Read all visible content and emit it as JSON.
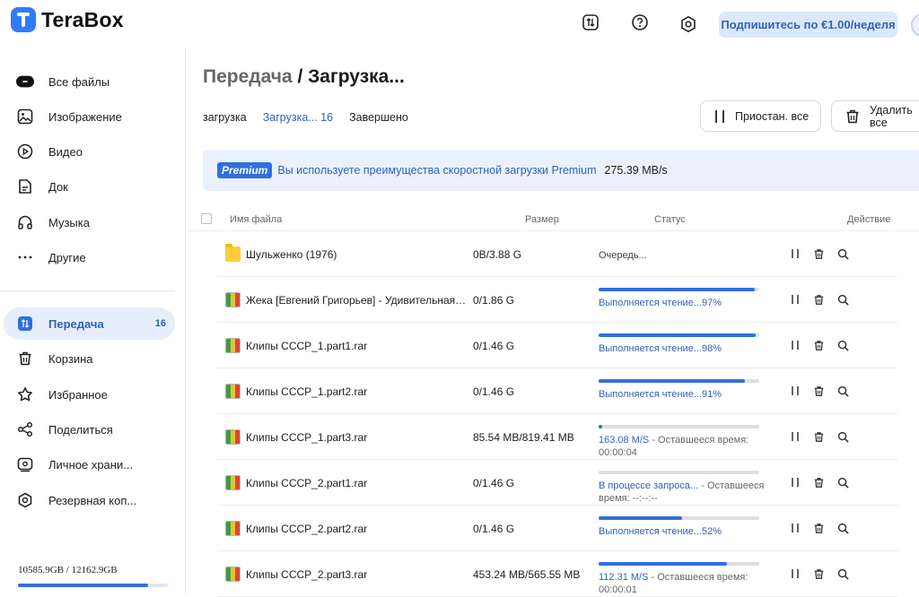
{
  "app": {
    "name": "TeraBox"
  },
  "header": {
    "subscribe_label": "Подпишитесь по €1.00/неделя"
  },
  "sidebar": {
    "items": [
      {
        "label": "Все файлы"
      },
      {
        "label": "Изображение"
      },
      {
        "label": "Видео"
      },
      {
        "label": "Док"
      },
      {
        "label": "Музыка"
      },
      {
        "label": "Другие"
      },
      {
        "label": "Передача",
        "count": "16"
      },
      {
        "label": "Корзина"
      },
      {
        "label": "Избранное"
      },
      {
        "label": "Поделиться"
      },
      {
        "label": "Личное храни..."
      },
      {
        "label": "Резервная коп..."
      }
    ],
    "storage": {
      "text": "10585.9GB / 12162.9GB",
      "used_fraction": 0.87
    }
  },
  "main": {
    "title_crumb": "Передача",
    "title_sep": " / ",
    "title_current": "Загрузка...",
    "tabs": [
      {
        "label": "загрузка"
      },
      {
        "label": "Загрузка... 16"
      },
      {
        "label": "Завершено"
      }
    ],
    "pause_all_label": "Приостан. все",
    "delete_label": "Удалить все",
    "banner": {
      "badge": "Premium",
      "text": "Вы используете преимущества скоростной загрузки Premium",
      "speed": "275.39 MB/s"
    },
    "columns": {
      "name": "Имя файла",
      "size": "Размер",
      "status": "Статус",
      "action": "Действие"
    },
    "rows": [
      {
        "type": "folder",
        "name": "Шульженко (1976)",
        "size": "0B/3.88 G",
        "status_plain": "Очередь...",
        "progress": null
      },
      {
        "type": "rar",
        "name": "Жека [Евгений Григорьев] - Удивительная жизнь",
        "size": "0/1.86 G",
        "status_main": "Выполняется чтение...97%",
        "status_extra": "",
        "progress": 0.97
      },
      {
        "type": "rar",
        "name": "Клипы СССР_1.part1.rar",
        "size": "0/1.46 G",
        "status_main": "Выполняется чтение...98%",
        "status_extra": "",
        "progress": 0.98
      },
      {
        "type": "rar",
        "name": "Клипы СССР_1.part2.rar",
        "size": "0/1.46 G",
        "status_main": "Выполняется чтение...91%",
        "status_extra": "",
        "progress": 0.91
      },
      {
        "type": "rar",
        "name": "Клипы СССР_1.part3.rar",
        "size": "85.54 MB/819.41 MB",
        "status_main": "163.08 M/S",
        "status_extra": " - Оставшееся время: 00:00:04",
        "progress": 0.02
      },
      {
        "type": "rar",
        "name": "Клипы СССР_2.part1.rar",
        "size": "0/1.46 G",
        "status_main": "В процессе запроса...",
        "status_extra": " - Оставшееся время: --:--:--",
        "progress": 0.0
      },
      {
        "type": "rar",
        "name": "Клипы СССР_2.part2.rar",
        "size": "0/1.46 G",
        "status_main": "Выполняется чтение...52%",
        "status_extra": "",
        "progress": 0.52
      },
      {
        "type": "rar",
        "name": "Клипы СССР_2.part3.rar",
        "size": "453.24 MB/565.55 MB",
        "status_main": "112.31 M/S",
        "status_extra": " - Оставшееся время: 00:00:01",
        "progress": 0.8
      }
    ]
  },
  "colors": {
    "accent": "#2f6fe0",
    "accent_text": "#2f63b8",
    "active_bg": "#e6eefb"
  }
}
